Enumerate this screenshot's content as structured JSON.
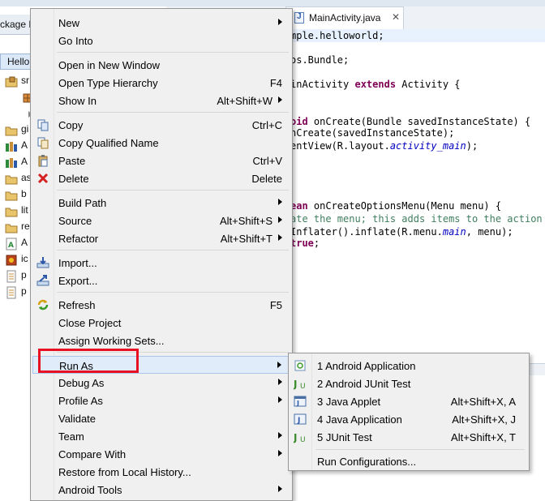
{
  "explorer": {
    "tab_label": "ckage E",
    "project_label": "Hello",
    "tree": [
      {
        "label": "sr",
        "icon": "package-folder-icon"
      },
      {
        "label": "",
        "icon": "package-icon"
      },
      {
        "label": "",
        "icon": "collapsed-arrow-icon"
      },
      {
        "label": "gi",
        "icon": "folder-icon"
      },
      {
        "label": "A",
        "icon": "library-icon"
      },
      {
        "label": "A",
        "icon": "library-icon"
      },
      {
        "label": "as",
        "icon": "folder-icon"
      },
      {
        "label": "b",
        "icon": "folder-icon"
      },
      {
        "label": "lit",
        "icon": "folder-icon"
      },
      {
        "label": "re",
        "icon": "folder-icon"
      },
      {
        "label": "A",
        "icon": "xml-file-icon"
      },
      {
        "label": "ic",
        "icon": "image-file-icon"
      },
      {
        "label": "p",
        "icon": "text-file-icon"
      },
      {
        "label": "p",
        "icon": "text-file-icon"
      }
    ]
  },
  "editor": {
    "tab_label": "MainActivity.java",
    "code": [
      {
        "segments": [
          {
            "t": "mple.helloworld;",
            "c": ""
          }
        ],
        "hl": true
      },
      {
        "segments": [
          {
            "t": "",
            "c": ""
          }
        ]
      },
      {
        "segments": [
          {
            "t": "os.Bundle;",
            "c": ""
          }
        ]
      },
      {
        "segments": [
          {
            "t": "",
            "c": ""
          }
        ]
      },
      {
        "segments": [
          {
            "t": "inActivity ",
            "c": ""
          },
          {
            "t": "extends",
            "c": "kw"
          },
          {
            "t": " Activity {",
            "c": ""
          }
        ]
      },
      {
        "segments": [
          {
            "t": "",
            "c": ""
          }
        ]
      },
      {
        "segments": [
          {
            "t": "",
            "c": ""
          }
        ]
      },
      {
        "segments": [
          {
            "t": "oid",
            "c": "kw"
          },
          {
            "t": " onCreate(Bundle savedInstanceState) {",
            "c": ""
          }
        ]
      },
      {
        "segments": [
          {
            "t": "nCreate(savedInstanceState);",
            "c": ""
          }
        ]
      },
      {
        "segments": [
          {
            "t": "entView(R.layout.",
            "c": ""
          },
          {
            "t": "activity_main",
            "c": "it"
          },
          {
            "t": ");",
            "c": ""
          }
        ]
      },
      {
        "segments": [
          {
            "t": "",
            "c": ""
          }
        ]
      },
      {
        "segments": [
          {
            "t": "",
            "c": ""
          }
        ]
      },
      {
        "segments": [
          {
            "t": "",
            "c": ""
          }
        ]
      },
      {
        "segments": [
          {
            "t": "",
            "c": ""
          }
        ]
      },
      {
        "segments": [
          {
            "t": "ean",
            "c": "kw"
          },
          {
            "t": " onCreateOptionsMenu(Menu menu) {",
            "c": ""
          }
        ]
      },
      {
        "segments": [
          {
            "t": "ate the menu; this adds items to the action b",
            "c": "cm"
          }
        ]
      },
      {
        "segments": [
          {
            "t": "Inflater().inflate(R.menu.",
            "c": ""
          },
          {
            "t": "main",
            "c": "it"
          },
          {
            "t": ", menu);",
            "c": ""
          }
        ]
      },
      {
        "segments": [
          {
            "t": "true",
            "c": "kw"
          },
          {
            "t": ";",
            "c": ""
          }
        ]
      }
    ]
  },
  "menu": {
    "items": [
      {
        "label": "New",
        "shortcut": "",
        "submenu": true,
        "icon": ""
      },
      {
        "label": "Go Into",
        "shortcut": "",
        "submenu": false,
        "icon": ""
      },
      {
        "sep": true
      },
      {
        "label": "Open in New Window",
        "shortcut": "",
        "submenu": false,
        "icon": ""
      },
      {
        "label": "Open Type Hierarchy",
        "shortcut": "F4",
        "submenu": false,
        "icon": ""
      },
      {
        "label": "Show In",
        "shortcut": "Alt+Shift+W",
        "submenu": true,
        "icon": ""
      },
      {
        "sep": true
      },
      {
        "label": "Copy",
        "shortcut": "Ctrl+C",
        "submenu": false,
        "icon": "copy-icon"
      },
      {
        "label": "Copy Qualified Name",
        "shortcut": "",
        "submenu": false,
        "icon": "copy-qualified-name-icon"
      },
      {
        "label": "Paste",
        "shortcut": "Ctrl+V",
        "submenu": false,
        "icon": "paste-icon"
      },
      {
        "label": "Delete",
        "shortcut": "Delete",
        "submenu": false,
        "icon": "delete-icon"
      },
      {
        "sep": true
      },
      {
        "label": "Build Path",
        "shortcut": "",
        "submenu": true,
        "icon": ""
      },
      {
        "label": "Source",
        "shortcut": "Alt+Shift+S",
        "submenu": true,
        "icon": ""
      },
      {
        "label": "Refactor",
        "shortcut": "Alt+Shift+T",
        "submenu": true,
        "icon": ""
      },
      {
        "sep": true
      },
      {
        "label": "Import...",
        "shortcut": "",
        "submenu": false,
        "icon": "import-icon"
      },
      {
        "label": "Export...",
        "shortcut": "",
        "submenu": false,
        "icon": "export-icon"
      },
      {
        "sep": true
      },
      {
        "label": "Refresh",
        "shortcut": "F5",
        "submenu": false,
        "icon": "refresh-icon"
      },
      {
        "label": "Close Project",
        "shortcut": "",
        "submenu": false,
        "icon": ""
      },
      {
        "label": "Assign Working Sets...",
        "shortcut": "",
        "submenu": false,
        "icon": ""
      },
      {
        "sep": true
      },
      {
        "label": "Run As",
        "shortcut": "",
        "submenu": true,
        "icon": "",
        "active": true
      },
      {
        "label": "Debug As",
        "shortcut": "",
        "submenu": true,
        "icon": ""
      },
      {
        "label": "Profile As",
        "shortcut": "",
        "submenu": true,
        "icon": ""
      },
      {
        "label": "Validate",
        "shortcut": "",
        "submenu": false,
        "icon": ""
      },
      {
        "label": "Team",
        "shortcut": "",
        "submenu": true,
        "icon": ""
      },
      {
        "label": "Compare With",
        "shortcut": "",
        "submenu": true,
        "icon": ""
      },
      {
        "label": "Restore from Local History...",
        "shortcut": "",
        "submenu": false,
        "icon": ""
      },
      {
        "label": "Android Tools",
        "shortcut": "",
        "submenu": true,
        "icon": ""
      }
    ]
  },
  "submenu": {
    "items": [
      {
        "label": "1 Android Application",
        "shortcut": "",
        "icon": "android-application-icon"
      },
      {
        "label": "2 Android JUnit Test",
        "shortcut": "",
        "icon": "junit-icon"
      },
      {
        "label": "3 Java Applet",
        "shortcut": "Alt+Shift+X, A",
        "icon": "java-applet-icon"
      },
      {
        "label": "4 Java Application",
        "shortcut": "Alt+Shift+X, J",
        "icon": "java-application-icon"
      },
      {
        "label": "5 JUnit Test",
        "shortcut": "Alt+Shift+X, T",
        "icon": "junit-icon"
      },
      {
        "sep": true
      },
      {
        "label": "Run Configurations...",
        "shortcut": "",
        "icon": ""
      }
    ]
  },
  "colors": {
    "highlight_box": "#e81123",
    "menu_bg": "#f0f0f0",
    "active_item": "#e1ecfa"
  }
}
